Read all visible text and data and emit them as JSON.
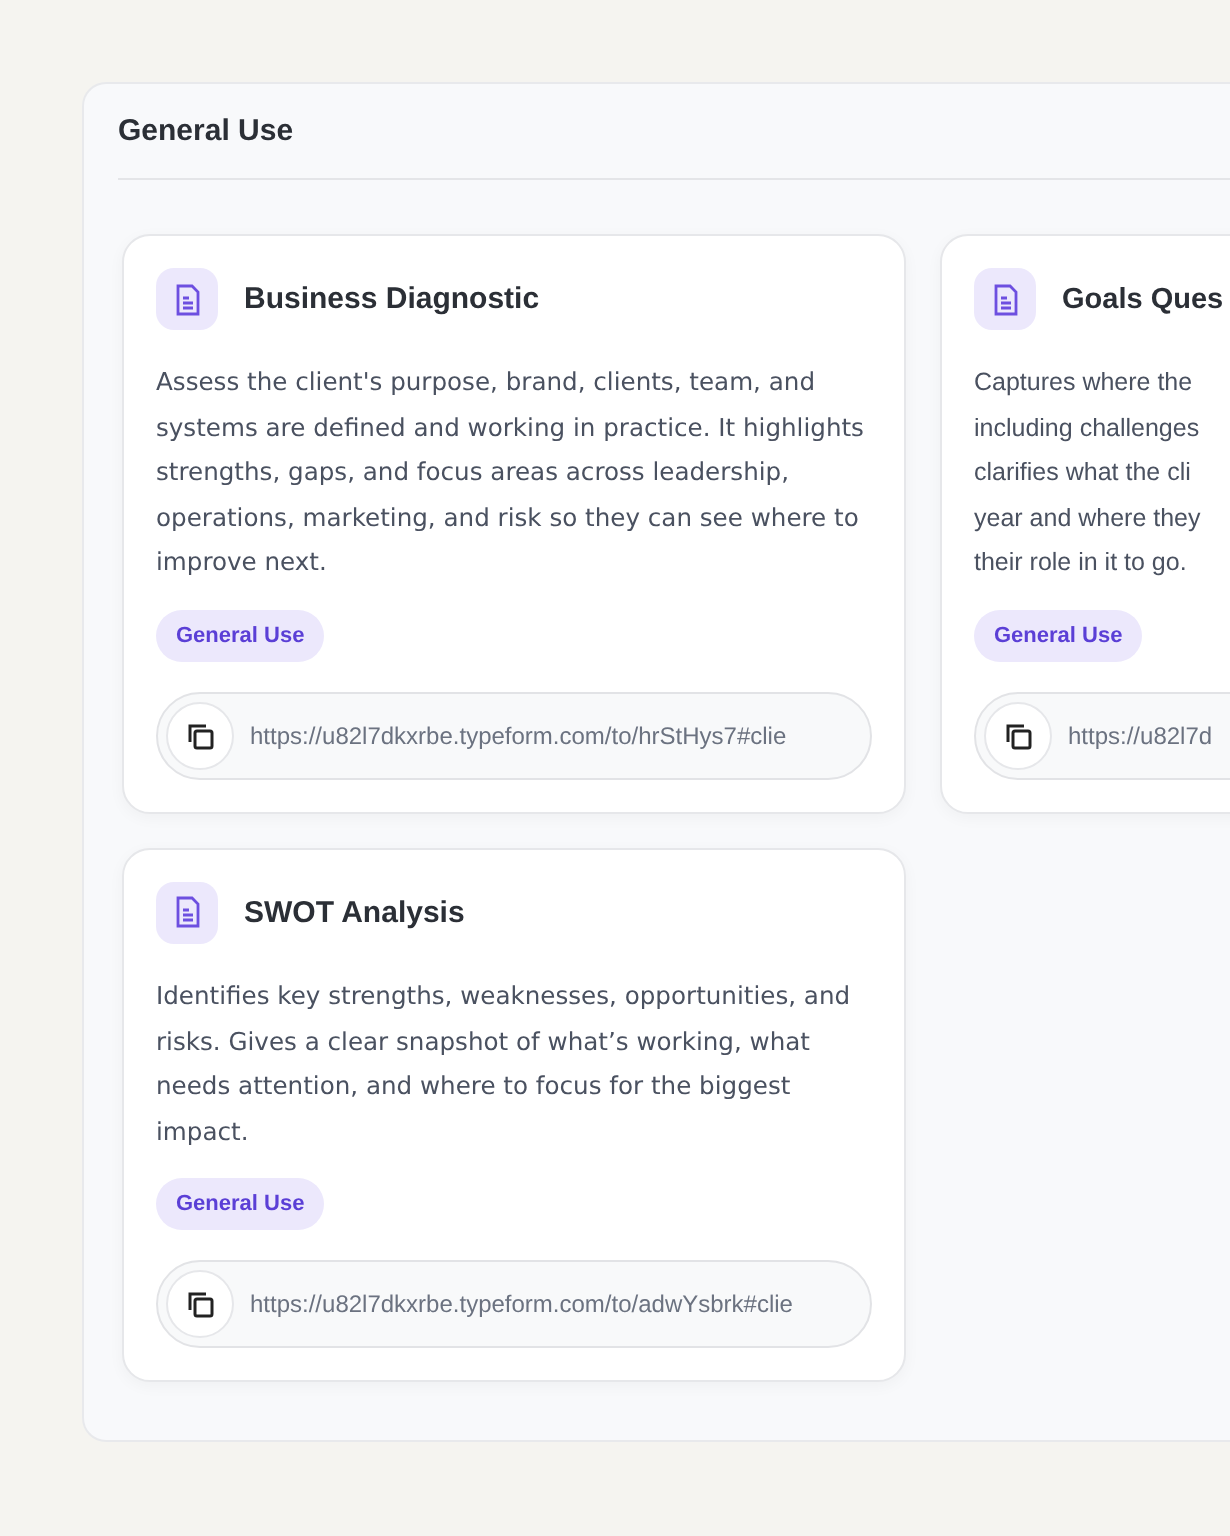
{
  "section": {
    "title": "General Use"
  },
  "cards": [
    {
      "title": "Business Diagnostic",
      "description": "Assess the client's purpose, brand, clients, team, and systems are defined and working in practice. It highlights strengths, gaps, and focus areas across leadership, operations, marketing, and risk so they can see where to improve next.",
      "tag": "General Use",
      "url": "https://u82l7dkxrbe.typeform.com/to/hrStHys7#clie"
    },
    {
      "title": "Goals Ques",
      "description": "Captures where the\nincluding challenges\nclarifies what the cli\nyear and where they\ntheir role in it to go.",
      "tag": "General Use",
      "url": "https://u82l7d"
    },
    {
      "title": "SWOT Analysis",
      "description": "Identifies key strengths, weaknesses, opportunities, and risks. Gives a clear snapshot of what’s working, what needs attention, and where to focus for the biggest impact.",
      "tag": "General Use",
      "url": "https://u82l7dkxrbe.typeform.com/to/adwYsbrk#clie"
    }
  ]
}
